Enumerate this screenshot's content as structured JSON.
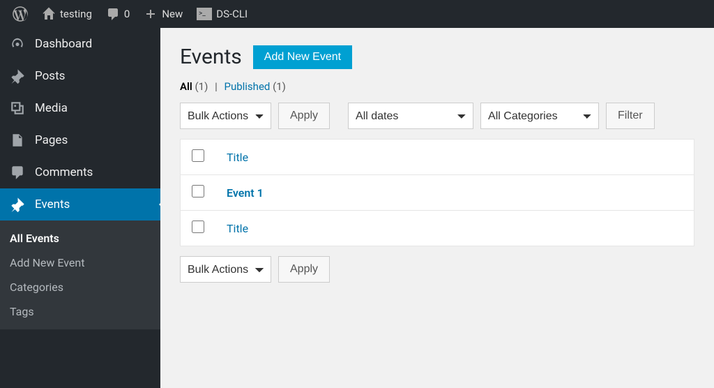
{
  "adminbar": {
    "site_name": "testing",
    "comments_count": "0",
    "new_label": "New",
    "dscli_label": "DS-CLI"
  },
  "sidebar": {
    "items": [
      {
        "label": "Dashboard",
        "icon": "dashboard"
      },
      {
        "label": "Posts",
        "icon": "pin"
      },
      {
        "label": "Media",
        "icon": "media"
      },
      {
        "label": "Pages",
        "icon": "page"
      },
      {
        "label": "Comments",
        "icon": "comment"
      },
      {
        "label": "Events",
        "icon": "pin",
        "active": true
      }
    ],
    "submenu": [
      {
        "label": "All Events",
        "current": true
      },
      {
        "label": "Add New Event"
      },
      {
        "label": "Categories"
      },
      {
        "label": "Tags"
      }
    ]
  },
  "page": {
    "title": "Events",
    "add_new_label": "Add New Event",
    "filters": {
      "all_label": "All",
      "all_count": "(1)",
      "published_label": "Published",
      "published_count": "(1)",
      "separator": "|"
    },
    "bulk_actions_label": "Bulk Actions",
    "apply_label": "Apply",
    "all_dates_label": "All dates",
    "all_categories_label": "All Categories",
    "filter_label": "Filter",
    "columns": {
      "title": "Title"
    },
    "rows": [
      {
        "title": "Event 1"
      }
    ]
  }
}
